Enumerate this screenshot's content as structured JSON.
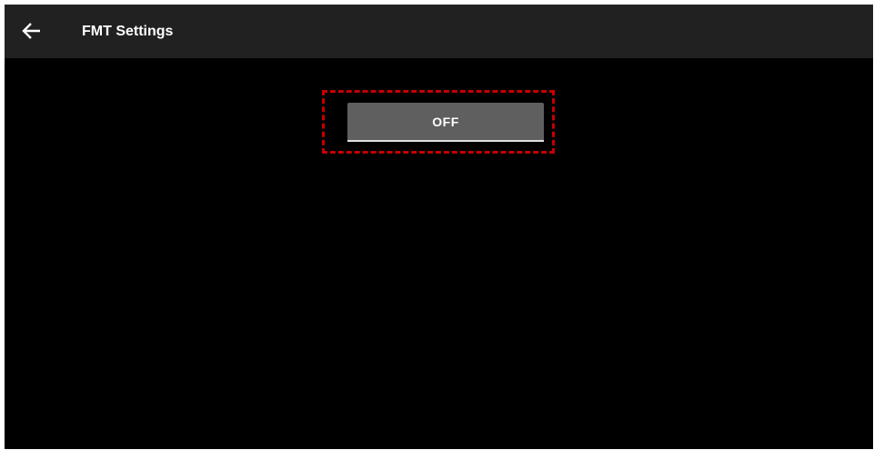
{
  "app_bar": {
    "title": "FMT Settings",
    "back_icon": "arrow-left-icon",
    "background": "#212121"
  },
  "main": {
    "fmt_toggle": {
      "label": "OFF",
      "background": "#5f5f5f",
      "underline_color": "#e0e0e0"
    },
    "highlight_color": "#c40000",
    "background": "#000000"
  }
}
